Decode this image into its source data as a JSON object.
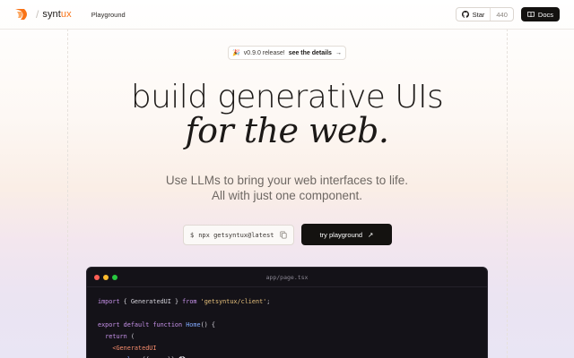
{
  "header": {
    "logo_prefix": "synt",
    "logo_accent": "ux",
    "logo_sep": "/",
    "nav_playground": "Playground",
    "star_label": "Star",
    "star_count": "440",
    "docs_label": "Docs"
  },
  "release": {
    "emoji": "🎉",
    "text": "v0.9.0 release!",
    "link": "see the details",
    "arrow": "→"
  },
  "hero": {
    "title": "build generative UIs",
    "subtitle": "for the web.",
    "tagline_line1": "Use LLMs to bring your web interfaces to life.",
    "tagline_line2": "All with just one component."
  },
  "cta": {
    "prompt": "$",
    "command": "npx getsyntux@latest",
    "button_label": "try playground",
    "button_arrow": "↗"
  },
  "code_window": {
    "filename": "app/page.tsx",
    "lines": [
      {
        "kw": "import",
        "text": " { GeneratedUI } ",
        "kw2": "from",
        "str": " 'getsyntux/client'",
        "end": ";"
      },
      {
        "kw": "export default function",
        "fn": " Home",
        "text": "() {"
      },
      {
        "kw": "return",
        "text": " ("
      },
      {
        "tag": "<GeneratedUI"
      },
      {
        "attr": "value",
        "text": "={{ ... }}"
      }
    ]
  },
  "colors": {
    "accent": "#f97316",
    "dark_button": "#141210",
    "code_bg": "#141218"
  },
  "icons": {
    "logo": "syntux-logo-icon",
    "github": "github-icon",
    "docs": "book-icon",
    "copy": "copy-icon",
    "help": "help-circle-icon"
  }
}
